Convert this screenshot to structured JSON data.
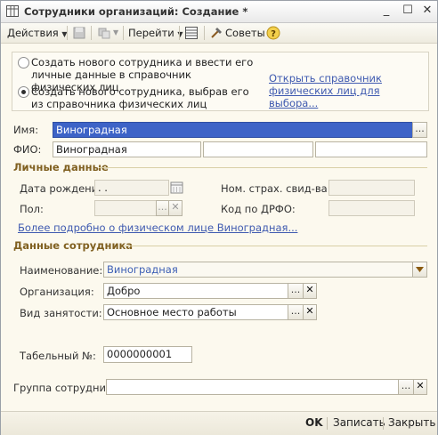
{
  "window": {
    "title": "Сотрудники организаций: Создание *"
  },
  "toolbar": {
    "actions_label": "Действия",
    "goto_label": "Перейти",
    "tips_label": "Советы"
  },
  "mode": {
    "option1": "Создать нового сотрудника и ввести его личные данные в справочник физических лиц",
    "option2": "Создать нового сотрудника, выбрав его из справочника физических лиц",
    "selected": "option2",
    "open_link": "Открыть справочник физических лиц для выбора..."
  },
  "person": {
    "name_label": "Имя:",
    "name_value": "Виноградная",
    "fio_label": "ФИО:",
    "fio_last": "Виноградная",
    "fio_first": "",
    "fio_middle": ""
  },
  "personal": {
    "section_title": "Личные данные",
    "birth_label": "Дата рождения:",
    "birth_value": " .  .",
    "gender_label": "Пол:",
    "gender_value": "",
    "insurance_label": "Ном. страх. свид-ва:",
    "insurance_value": "",
    "tax_label": "Код по ДРФО:",
    "tax_value": "",
    "more_link": "Более подробно о физическом лице Виноградная..."
  },
  "employee": {
    "section_title": "Данные сотрудника",
    "name_label": "Наименование:",
    "name_value": "Виноградная",
    "org_label": "Организация:",
    "org_value": "Добро",
    "employment_label": "Вид занятости:",
    "employment_value": "Основное место работы",
    "tabnum_label": "Табельный №:",
    "tabnum_value": "0000000001",
    "group_label": "Группа сотрудника:",
    "group_value": ""
  },
  "footer": {
    "ok_label": "OK",
    "save_label": "Записать",
    "close_label": "Закрыть"
  },
  "colors": {
    "accent_section": "#806020",
    "link": "#3f5ab0",
    "selection": "#3d63c7"
  }
}
